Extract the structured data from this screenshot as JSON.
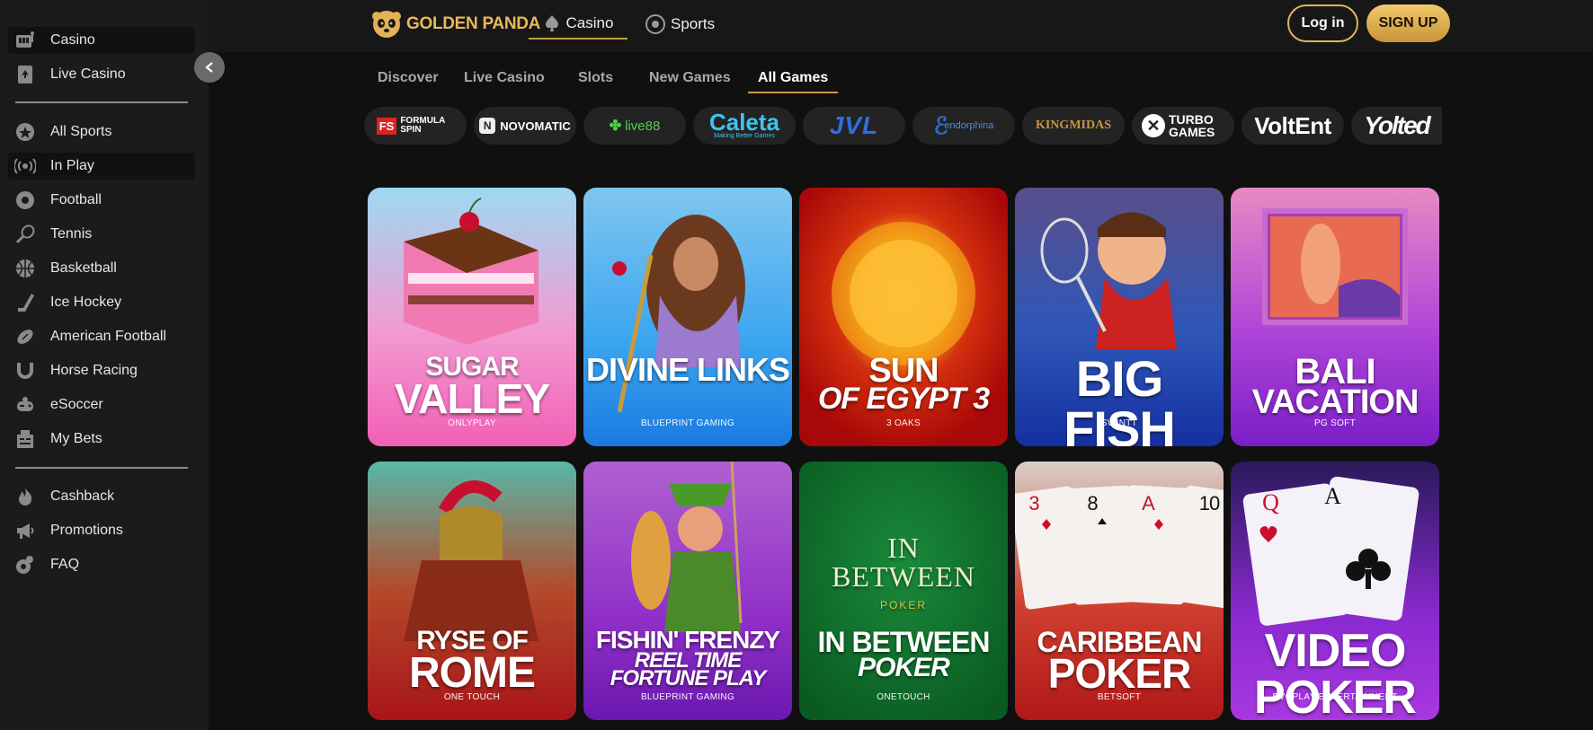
{
  "sidebar": {
    "items": [
      {
        "label": "Casino",
        "icon": "casino-icon"
      },
      {
        "label": "Live Casino",
        "icon": "live-casino-icon"
      },
      {
        "label": "All Sports",
        "icon": "all-sports-icon"
      },
      {
        "label": "In Play",
        "icon": "in-play-icon"
      },
      {
        "label": "Football",
        "icon": "football-icon"
      },
      {
        "label": "Tennis",
        "icon": "tennis-icon"
      },
      {
        "label": "Basketball",
        "icon": "basketball-icon"
      },
      {
        "label": "Ice Hockey",
        "icon": "ice-hockey-icon"
      },
      {
        "label": "American Football",
        "icon": "american-football-icon"
      },
      {
        "label": "Horse Racing",
        "icon": "horseshoe-icon"
      },
      {
        "label": "eSoccer",
        "icon": "gamepad-icon"
      },
      {
        "label": "My Bets",
        "icon": "my-bets-icon"
      },
      {
        "label": "Cashback",
        "icon": "flame-icon"
      },
      {
        "label": "Promotions",
        "icon": "megaphone-icon"
      },
      {
        "label": "FAQ",
        "icon": "faq-icon"
      }
    ]
  },
  "header": {
    "logo_text": "GOLDEN PANDA",
    "tabs": [
      {
        "label": "Casino",
        "icon": "spade-icon"
      },
      {
        "label": "Sports",
        "icon": "ball-icon"
      }
    ],
    "login_label": "Log in",
    "signup_label": "SIGN UP"
  },
  "subnav": {
    "tabs": [
      {
        "label": "Discover"
      },
      {
        "label": "Live Casino"
      },
      {
        "label": "Slots"
      },
      {
        "label": "New Games"
      },
      {
        "label": "All Games"
      }
    ]
  },
  "providers": [
    {
      "name": "FORMULA SPIN"
    },
    {
      "name": "NOVOMATIC"
    },
    {
      "name": "live88"
    },
    {
      "name": "Caleta",
      "tagline": "Making Better Games"
    },
    {
      "name": "JVL"
    },
    {
      "name": "endorphina"
    },
    {
      "name": "KINGMIDAS"
    },
    {
      "name": "TURBO GAMES"
    },
    {
      "name": "VoltEnt"
    },
    {
      "name": "Yolted"
    }
  ],
  "games": [
    {
      "title": [
        "SUGAR",
        "VALLEY"
      ],
      "provider": "ONLYPLAY"
    },
    {
      "title": [
        "DIVINE LINKS"
      ],
      "provider": "BLUEPRINT GAMING"
    },
    {
      "title": [
        "SUN",
        "OF EGYPT 3"
      ],
      "provider": "3 OAKS"
    },
    {
      "title": [
        "BIG FISH"
      ],
      "provider": "SWINTT"
    },
    {
      "title": [
        "BALI",
        "VACATION"
      ],
      "provider": "PG SOFT"
    },
    {
      "title": [
        "RYSE OF",
        "ROME"
      ],
      "provider": "ONE TOUCH"
    },
    {
      "title": [
        "FISHIN' FRENZY",
        "REEL TIME",
        "FORTUNE PLAY"
      ],
      "provider": "BLUEPRINT GAMING"
    },
    {
      "title": [
        "IN BETWEEN",
        "POKER"
      ],
      "provider": "ONETOUCH",
      "art_text": [
        "IN",
        "BETWEEN",
        "POKER"
      ]
    },
    {
      "title": [
        "CARIBBEAN",
        "POKER"
      ],
      "provider": "BETSOFT",
      "art_text": [
        "3",
        "8",
        "A",
        "10"
      ]
    },
    {
      "title": [
        "VIDEO POKER"
      ],
      "provider": "EVOPLAY ENTERTAINMENT",
      "art_text": [
        "Q",
        "A"
      ]
    }
  ]
}
